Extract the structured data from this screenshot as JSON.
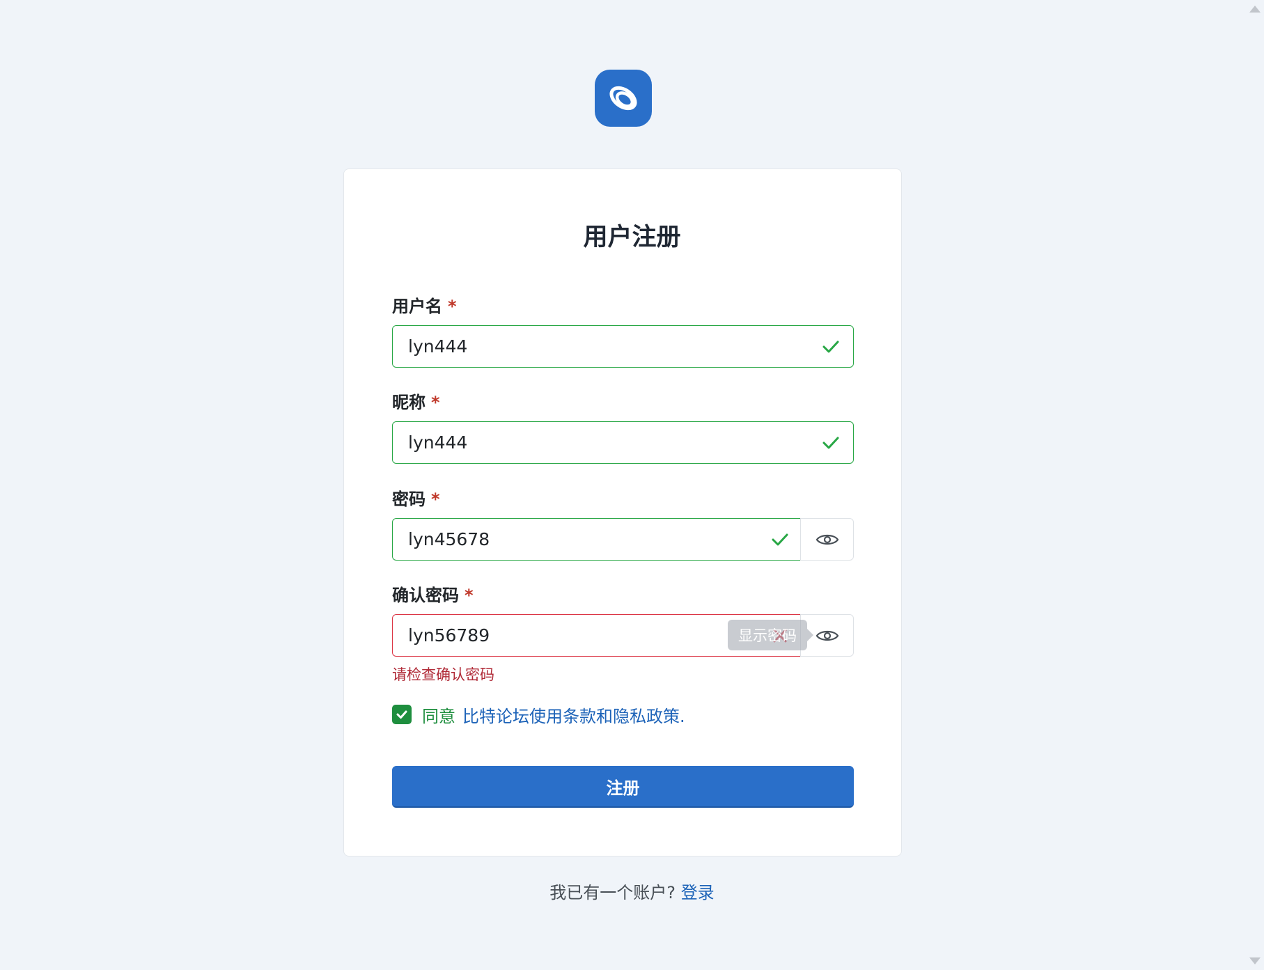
{
  "form": {
    "title": "用户注册",
    "required_mark": "*",
    "username": {
      "label": "用户名",
      "value": "lyn444",
      "status": "valid",
      "status_icon": "check-icon"
    },
    "nickname": {
      "label": "昵称",
      "value": "lyn444",
      "status": "valid",
      "status_icon": "check-icon"
    },
    "password": {
      "label": "密码",
      "value": "lyn45678",
      "status": "valid",
      "status_icon": "check-icon",
      "toggle_icon": "eye-icon"
    },
    "confirm_password": {
      "label": "确认密码",
      "value": "lyn56789",
      "status": "invalid",
      "status_icon": "x-icon",
      "toggle_icon": "eye-icon",
      "tooltip": "显示密码",
      "error": "请检查确认密码"
    },
    "agreement": {
      "checked": true,
      "agree_text": "同意",
      "link_text": "比特论坛使用条款和隐私政策."
    },
    "submit_label": "注册"
  },
  "footer": {
    "prompt": "我已有一个账户?",
    "login_link": "登录"
  },
  "colors": {
    "background": "#f0f4f9",
    "primary": "#2a6fc9",
    "valid": "#28a745",
    "invalid": "#dc3545",
    "link": "#1d63b8",
    "agree_green": "#1e8e3e"
  },
  "icons": {
    "logo": "app-logo-icon",
    "valid": "check-icon",
    "invalid": "x-icon",
    "toggle": "eye-icon",
    "checkbox": "checkbox-checked-icon"
  }
}
